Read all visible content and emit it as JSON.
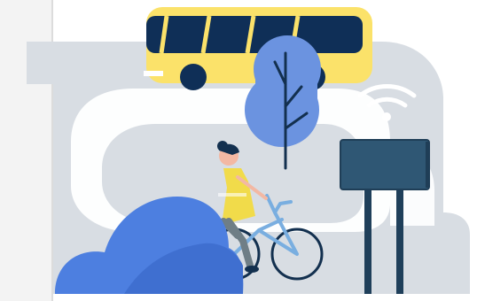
{
  "illustration": {
    "subject": "transit-city-illustration",
    "elements": [
      "bus-icon",
      "tree-icon",
      "wifi-icon",
      "sign-board",
      "cyclist",
      "bicycle-icon",
      "bush-icon"
    ]
  },
  "colors": {
    "background": "#ffffff",
    "side_panel": "#f3f3f3",
    "side_divider": "#dcdcdc",
    "backdrop_gray": "#d8dde3",
    "bus_yellow": "#fbe26a",
    "bus_navy": "#0f2f57",
    "tree_blue": "#6b93e0",
    "bush_blue": "#4d7fe0",
    "bush_dark": "#3f6fd0",
    "sign_dark": "#2f5774",
    "sign_frame": "#1f3e57",
    "pole_navy": "#1f3f5a",
    "cyclist_yellow": "#f1db4a",
    "bike_blue": "#79aee0",
    "hair_navy": "#13304f",
    "skin": "#f3b8a3",
    "pants_gray": "#6f7e86",
    "wifi_white": "#ffffff"
  }
}
